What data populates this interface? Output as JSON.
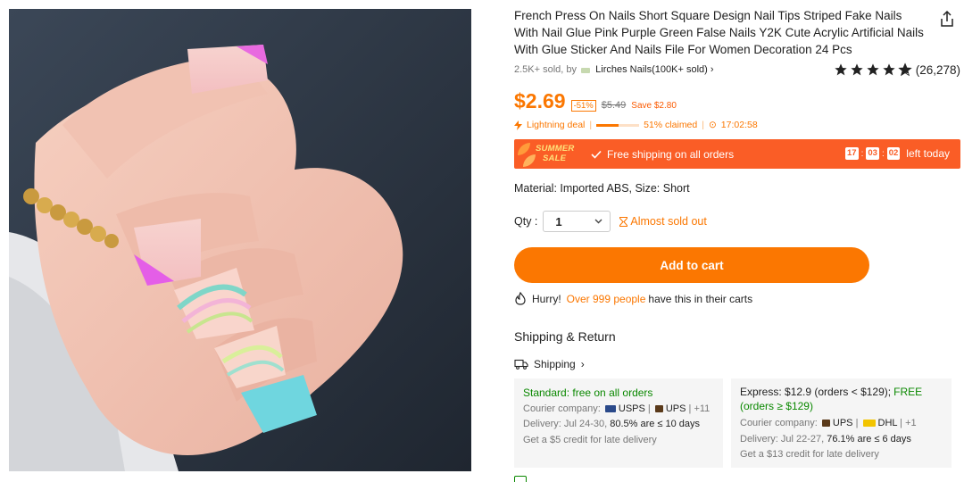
{
  "product": {
    "title": "French Press On Nails Short Square Design Nail Tips Striped Fake Nails With Nail Glue Pink Purple Green False Nails Y2K Cute Acrylic Artificial Nails With Glue Sticker And Nails File For Women Decoration 24 Pcs",
    "image_alt": "Hand wearing pink tipped and swirled pastel square press-on nails with a gold ring"
  },
  "seller": {
    "sold_prefix": "2.5K+ sold, by",
    "store_name": "Lirches Nails(100K+ sold)",
    "chevron": "›"
  },
  "rating": {
    "stars": 4.5,
    "count": "(26,278)"
  },
  "price": {
    "current": "$2.69",
    "discount": "-51%",
    "original": "$5.49",
    "save": "Save $2.80"
  },
  "deal": {
    "label": "Lightning deal",
    "claimed_fraction": 0.51,
    "claimed_text": "51% claimed",
    "timer": "17:02:58"
  },
  "banner": {
    "badge_line1": "SUMMER",
    "badge_line2": "SALE",
    "free_shipping": "Free shipping on all orders",
    "countdown": {
      "h": "17",
      "m": "03",
      "s": "02"
    },
    "suffix": "left today",
    "color": "#fa5d26"
  },
  "specs": {
    "material": "Material: Imported ABS, Size: Short"
  },
  "quantity": {
    "label": "Qty :",
    "value": "1",
    "stock_note": "Almost sold out"
  },
  "cart": {
    "button_label": "Add to cart",
    "accent": "#fb7701"
  },
  "hurry": {
    "prefix": "Hurry!",
    "highlight": "Over 999 people",
    "suffix": "have this in their carts"
  },
  "shipping": {
    "heading": "Shipping & Return",
    "link": "Shipping",
    "standard": {
      "title": "Standard: free on all orders",
      "courier_label": "Courier company:",
      "courier1": "USPS",
      "courier2": "UPS",
      "more": "+11",
      "delivery_label": "Delivery: Jul 24-30,",
      "delivery_rate": "80.5% are ≤ 10 days",
      "credit": "Get a $5 credit for late delivery"
    },
    "express": {
      "title_a": "Express: $12.9 (orders < $129);",
      "title_b": "FREE (orders ≥ $129)",
      "courier_label": "Courier company:",
      "courier1": "UPS",
      "courier2": "DHL",
      "more": "+1",
      "delivery_label": "Delivery: Jul 22-27,",
      "delivery_rate": "76.1% are ≤ 6 days",
      "credit": "Get a $13 credit for late delivery"
    }
  }
}
